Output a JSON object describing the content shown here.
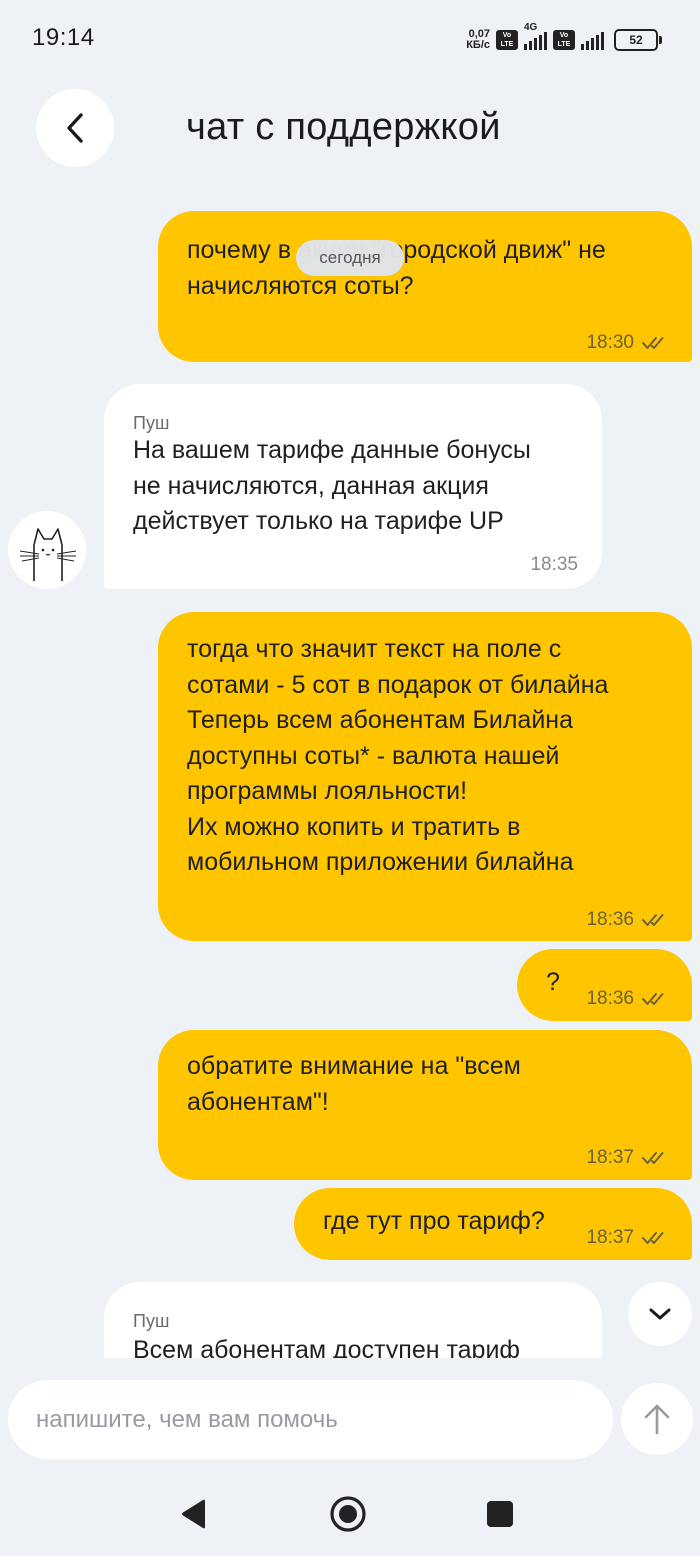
{
  "status_bar": {
    "time": "19:14",
    "net_speed_value": "0,07",
    "net_speed_unit": "КБ/с",
    "volte_top": "Vo",
    "volte_bottom": "LTE",
    "network_type": "4G",
    "battery": "52"
  },
  "header": {
    "title": "чат с поддержкой",
    "back_icon": "chevron-left-icon"
  },
  "chat": {
    "date_chip": "сегодня",
    "messages": [
      {
        "direction": "outgoing",
        "text": "почему в акции \"городской движ\" не\nначисляются соты?",
        "time": "18:30",
        "status": "read"
      },
      {
        "direction": "incoming",
        "sender": "Пуш",
        "text": "На вашем тарифе данные бонусы\nне начисляются, данная акция\nдействует только на тарифе UP",
        "time": "18:35"
      },
      {
        "direction": "outgoing",
        "text": "тогда что значит текст на поле с\nсотами - 5 сот в подарок от билайна\nТеперь всем абонентам Билайна\nдоступны соты* - валюта нашей\nпрограммы лояльности!\nИх можно копить и тратить в\nмобильном приложении билайна",
        "time": "18:36",
        "status": "read"
      },
      {
        "direction": "outgoing",
        "text": "?",
        "time": "18:36",
        "status": "read"
      },
      {
        "direction": "outgoing",
        "text": "обратите внимание на \"всем\nабонентам\"!",
        "time": "18:37",
        "status": "read"
      },
      {
        "direction": "outgoing",
        "text": "где тут про тариф?",
        "time": "18:37",
        "status": "read"
      },
      {
        "direction": "incoming",
        "sender": "Пуш",
        "text": "Всем абонентам доступен тариф"
      }
    ]
  },
  "composer": {
    "placeholder": "напишите, чем вам помочь",
    "value": "",
    "send_icon": "arrow-up-icon"
  },
  "navigation": {
    "back_icon": "triangle-back-icon",
    "home_icon": "circle-home-icon",
    "recents_icon": "square-recents-icon"
  },
  "colors": {
    "background": "#eef2f6",
    "outgoing_bubble": "#ffc600",
    "incoming_bubble": "#ffffff"
  }
}
